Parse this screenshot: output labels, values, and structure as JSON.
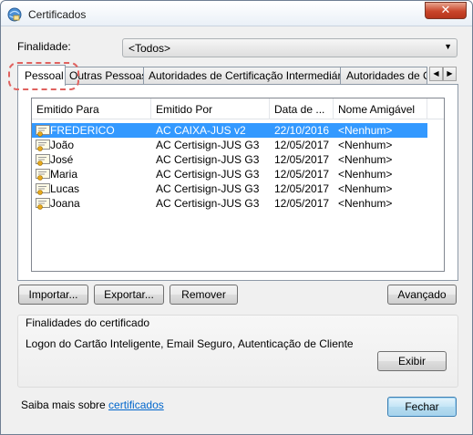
{
  "window": {
    "title": "Certificados"
  },
  "purpose": {
    "label": "Finalidade:",
    "value": "<Todos>"
  },
  "tabs": [
    {
      "label": "Pessoal",
      "active": true
    },
    {
      "label": "Outras Pessoas",
      "active": false
    },
    {
      "label": "Autoridades de Certificação Intermediárias",
      "active": false
    },
    {
      "label": "Autoridades de Certificação Raiz Confiáveis",
      "active": false
    }
  ],
  "table": {
    "columns": [
      "Emitido Para",
      "Emitido Por",
      "Data de ...",
      "Nome Amigável"
    ],
    "rows": [
      {
        "issued_to": "FREDERICO",
        "issued_by": "AC CAIXA-JUS v2",
        "date": "22/10/2016",
        "friendly": "<Nenhum>",
        "selected": true
      },
      {
        "issued_to": "João",
        "issued_by": "AC Certisign-JUS G3",
        "date": "12/05/2017",
        "friendly": "<Nenhum>",
        "selected": false
      },
      {
        "issued_to": "José",
        "issued_by": "AC Certisign-JUS G3",
        "date": "12/05/2017",
        "friendly": "<Nenhum>",
        "selected": false
      },
      {
        "issued_to": "Maria",
        "issued_by": "AC Certisign-JUS G3",
        "date": "12/05/2017",
        "friendly": "<Nenhum>",
        "selected": false
      },
      {
        "issued_to": "Lucas",
        "issued_by": "AC Certisign-JUS G3",
        "date": "12/05/2017",
        "friendly": "<Nenhum>",
        "selected": false
      },
      {
        "issued_to": "Joana",
        "issued_by": "AC Certisign-JUS G3",
        "date": "12/05/2017",
        "friendly": "<Nenhum>",
        "selected": false
      }
    ]
  },
  "buttons": {
    "import": "Importar...",
    "export": "Exportar...",
    "remove": "Remover",
    "advanced": "Avançado",
    "view": "Exibir",
    "close": "Fechar"
  },
  "purposes_group": {
    "title": "Finalidades do certificado",
    "text": "Logon do Cartão Inteligente, Email Seguro, Autenticação de Cliente"
  },
  "learn_more": {
    "prefix": "Saiba mais sobre ",
    "link": "certificados"
  },
  "icons": {
    "app": "certificate-app-icon",
    "close": "close-icon",
    "dropdown": "chevron-down-icon",
    "tab_left": "chevron-left-icon",
    "tab_right": "chevron-right-icon",
    "certificate": "certificate-icon"
  },
  "colors": {
    "selection": "#3399ff",
    "link": "#0066cc",
    "close_button": "#c9452a",
    "highlight": "#e0625f"
  }
}
